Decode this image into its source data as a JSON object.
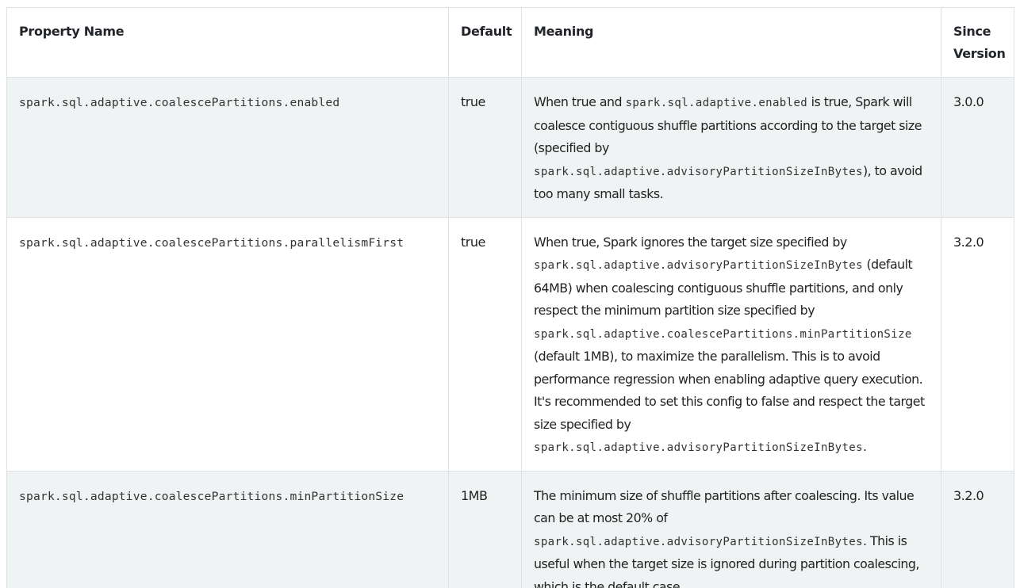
{
  "table": {
    "headers": {
      "property_name": "Property Name",
      "default": "Default",
      "meaning": "Meaning",
      "since_version": "Since Version"
    },
    "rows": [
      {
        "property": "spark.sql.adaptive.coalescePartitions.enabled",
        "default": "true",
        "meaning": [
          {
            "text": "When true and ",
            "code": false
          },
          {
            "text": "spark.sql.adaptive.enabled",
            "code": true
          },
          {
            "text": " is true, Spark will coalesce contiguous shuffle partitions according to the target size (specified by ",
            "code": false
          },
          {
            "text": "spark.sql.adaptive.advisoryPartitionSizeInBytes",
            "code": true
          },
          {
            "text": "), to avoid too many small tasks.",
            "code": false
          }
        ],
        "since": "3.0.0"
      },
      {
        "property": "spark.sql.adaptive.coalescePartitions.parallelismFirst",
        "default": "true",
        "meaning": [
          {
            "text": "When true, Spark ignores the target size specified by ",
            "code": false
          },
          {
            "text": "spark.sql.adaptive.advisoryPartitionSizeInBytes",
            "code": true
          },
          {
            "text": " (default 64MB) when coalescing contiguous shuffle partitions, and only respect the minimum partition size specified by ",
            "code": false
          },
          {
            "text": "spark.sql.adaptive.coalescePartitions.minPartitionSize",
            "code": true
          },
          {
            "text": " (default 1MB), to maximize the parallelism. This is to avoid performance regression when enabling adaptive query execution. It's recommended to set this config to false and respect the target size specified by ",
            "code": false
          },
          {
            "text": "spark.sql.adaptive.advisoryPartitionSizeInBytes",
            "code": true
          },
          {
            "text": ".",
            "code": false
          }
        ],
        "since": "3.2.0"
      },
      {
        "property": "spark.sql.adaptive.coalescePartitions.minPartitionSize",
        "default": "1MB",
        "meaning": [
          {
            "text": "The minimum size of shuffle partitions after coalescing. Its value can be at most 20% of ",
            "code": false
          },
          {
            "text": "spark.sql.adaptive.advisoryPartitionSizeInBytes",
            "code": true
          },
          {
            "text": ". This is useful when the target size is ignored during partition coalescing, which is the default case.",
            "code": false
          }
        ],
        "since": "3.2.0"
      }
    ]
  }
}
